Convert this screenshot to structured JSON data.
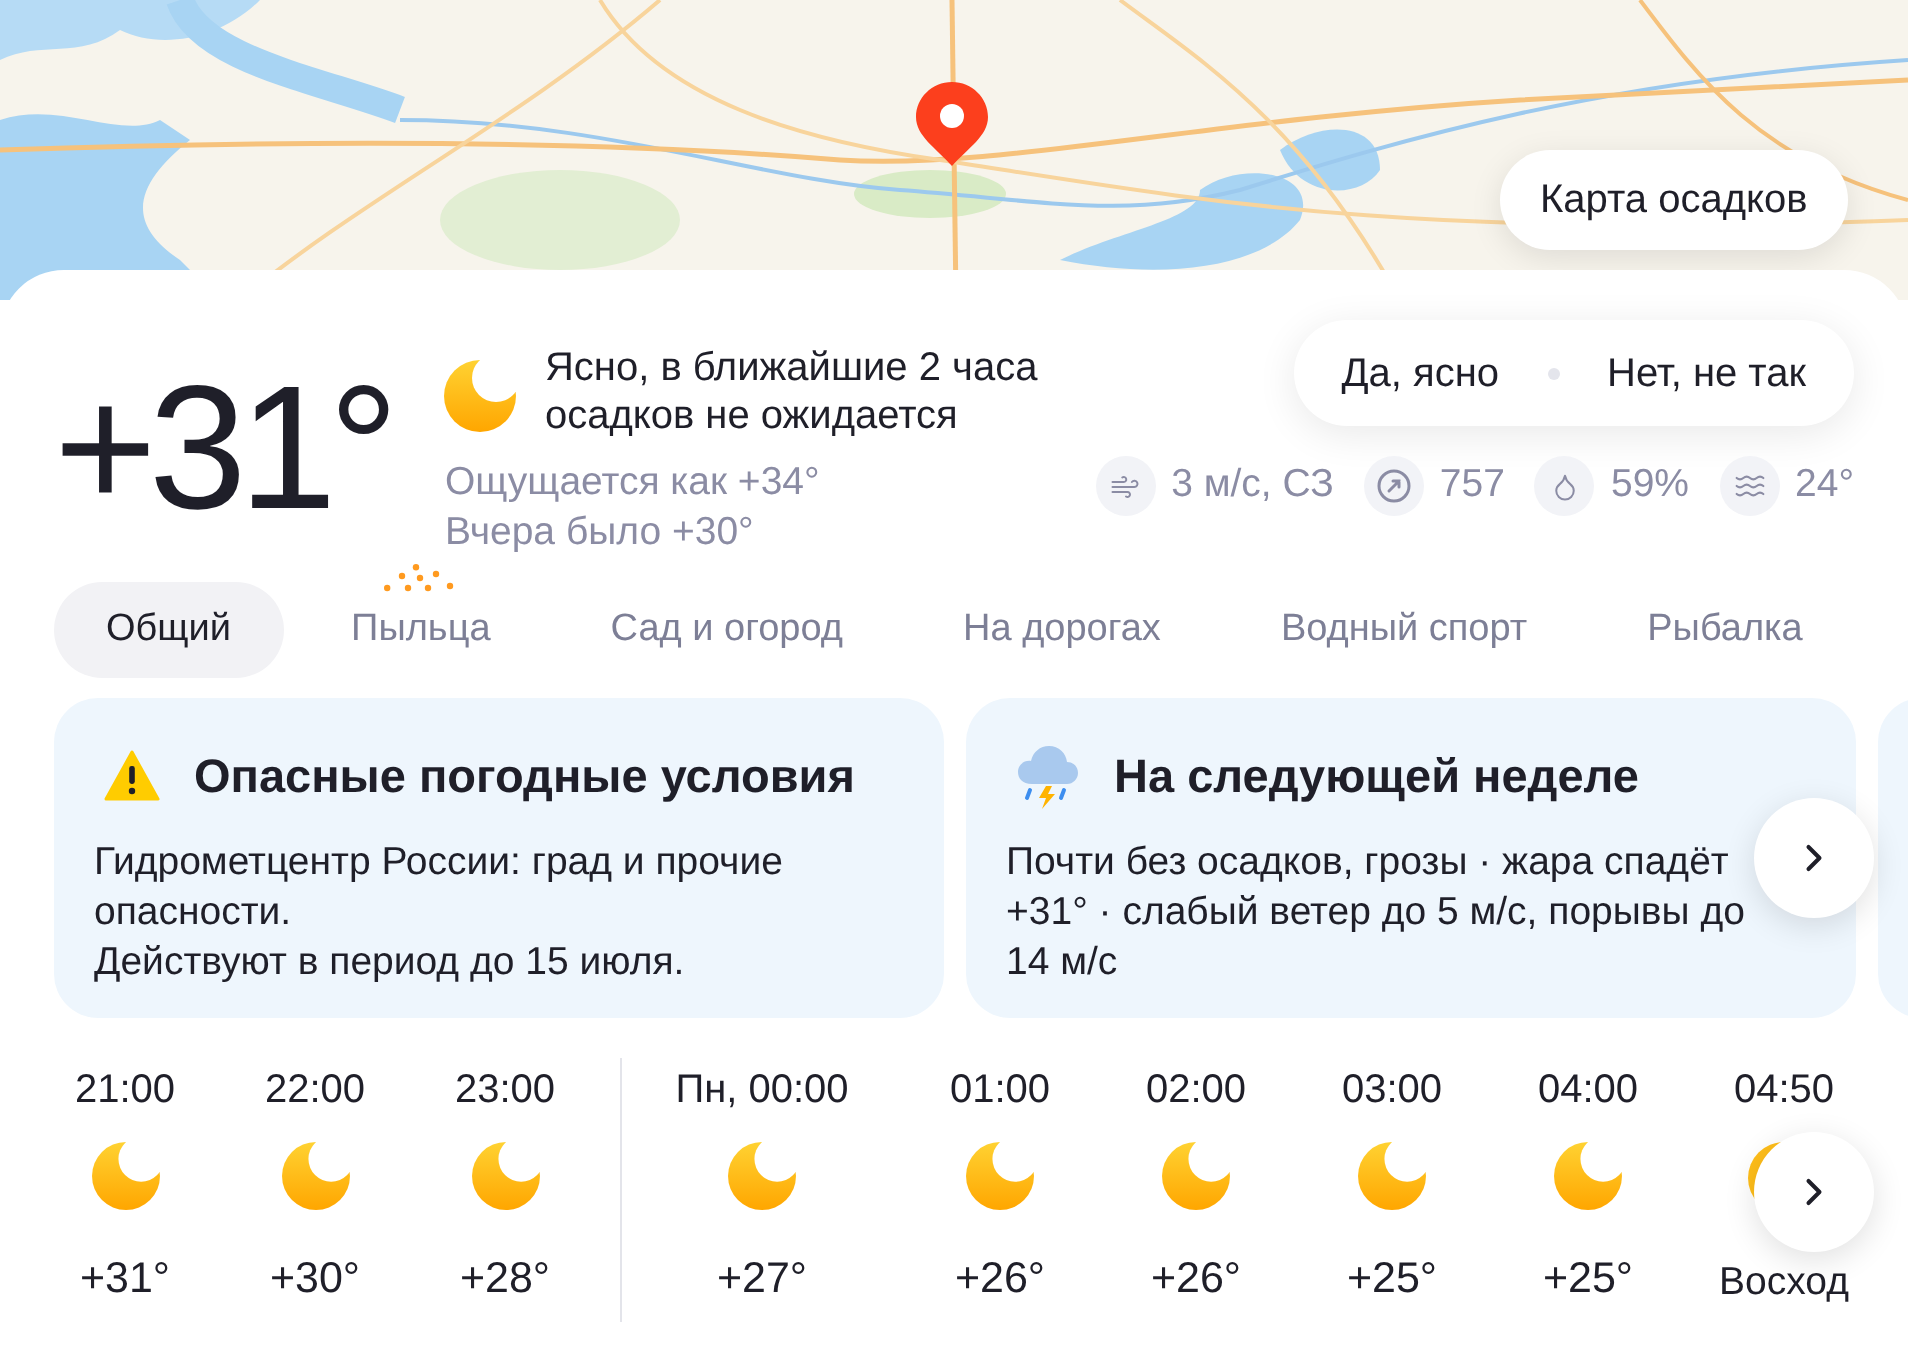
{
  "map": {
    "button": "Карта осадков"
  },
  "current": {
    "temperature": "+31°",
    "condition": "Ясно, в ближайшие 2 часа осадков не ожидается",
    "feels_like": "Ощущается как +34°",
    "yesterday": "Вчера было +30°"
  },
  "feedback": {
    "buttons": [
      "Да, ясно",
      "Нет, не так"
    ]
  },
  "details": [
    {
      "kind": "wind",
      "value": "3 м/с, СЗ"
    },
    {
      "kind": "pressure",
      "value": "757"
    },
    {
      "kind": "humidity",
      "value": "59%"
    },
    {
      "kind": "water",
      "value": "24°"
    }
  ],
  "tabs": [
    {
      "label": "Общий",
      "selected": true,
      "kind": "plain"
    },
    {
      "label": "Пыльца",
      "selected": false,
      "kind": "pollen"
    },
    {
      "label": "Сад и огород",
      "selected": false,
      "kind": "plain"
    },
    {
      "label": "На дорогах",
      "selected": false,
      "kind": "plain"
    },
    {
      "label": "Водный спорт",
      "selected": false,
      "kind": "plain"
    },
    {
      "label": "Рыбалка",
      "selected": false,
      "kind": "plain"
    }
  ],
  "cards": [
    {
      "kind": "warning",
      "title": "Опасные погодные условия",
      "text": [
        "Гидрометцентр России: град и прочие опасности.",
        "Действуют в период до 15 июля."
      ]
    },
    {
      "kind": "forecast",
      "title": "На следующей неделе",
      "text": [
        "Почти без осадков, грозы · жара спадёт",
        "+31° · слабый ветер до 5 м/с, порывы до",
        "14 м/с"
      ]
    }
  ],
  "hourly": [
    {
      "items": [
        {
          "kind": "hour",
          "time": "21:00",
          "value": "+31°"
        },
        {
          "kind": "hour",
          "time": "22:00",
          "value": "+30°"
        },
        {
          "kind": "hour",
          "time": "23:00",
          "value": "+28°"
        }
      ]
    },
    {
      "items": [
        {
          "kind": "hour",
          "time": "Пн, 00:00",
          "value": "+27°"
        },
        {
          "kind": "hour",
          "time": "01:00",
          "value": "+26°"
        },
        {
          "kind": "hour",
          "time": "02:00",
          "value": "+26°"
        },
        {
          "kind": "hour",
          "time": "03:00",
          "value": "+25°"
        },
        {
          "kind": "hour",
          "time": "04:00",
          "value": "+25°"
        },
        {
          "kind": "sunrise",
          "time": "04:50",
          "value": "Восход"
        }
      ]
    }
  ]
}
